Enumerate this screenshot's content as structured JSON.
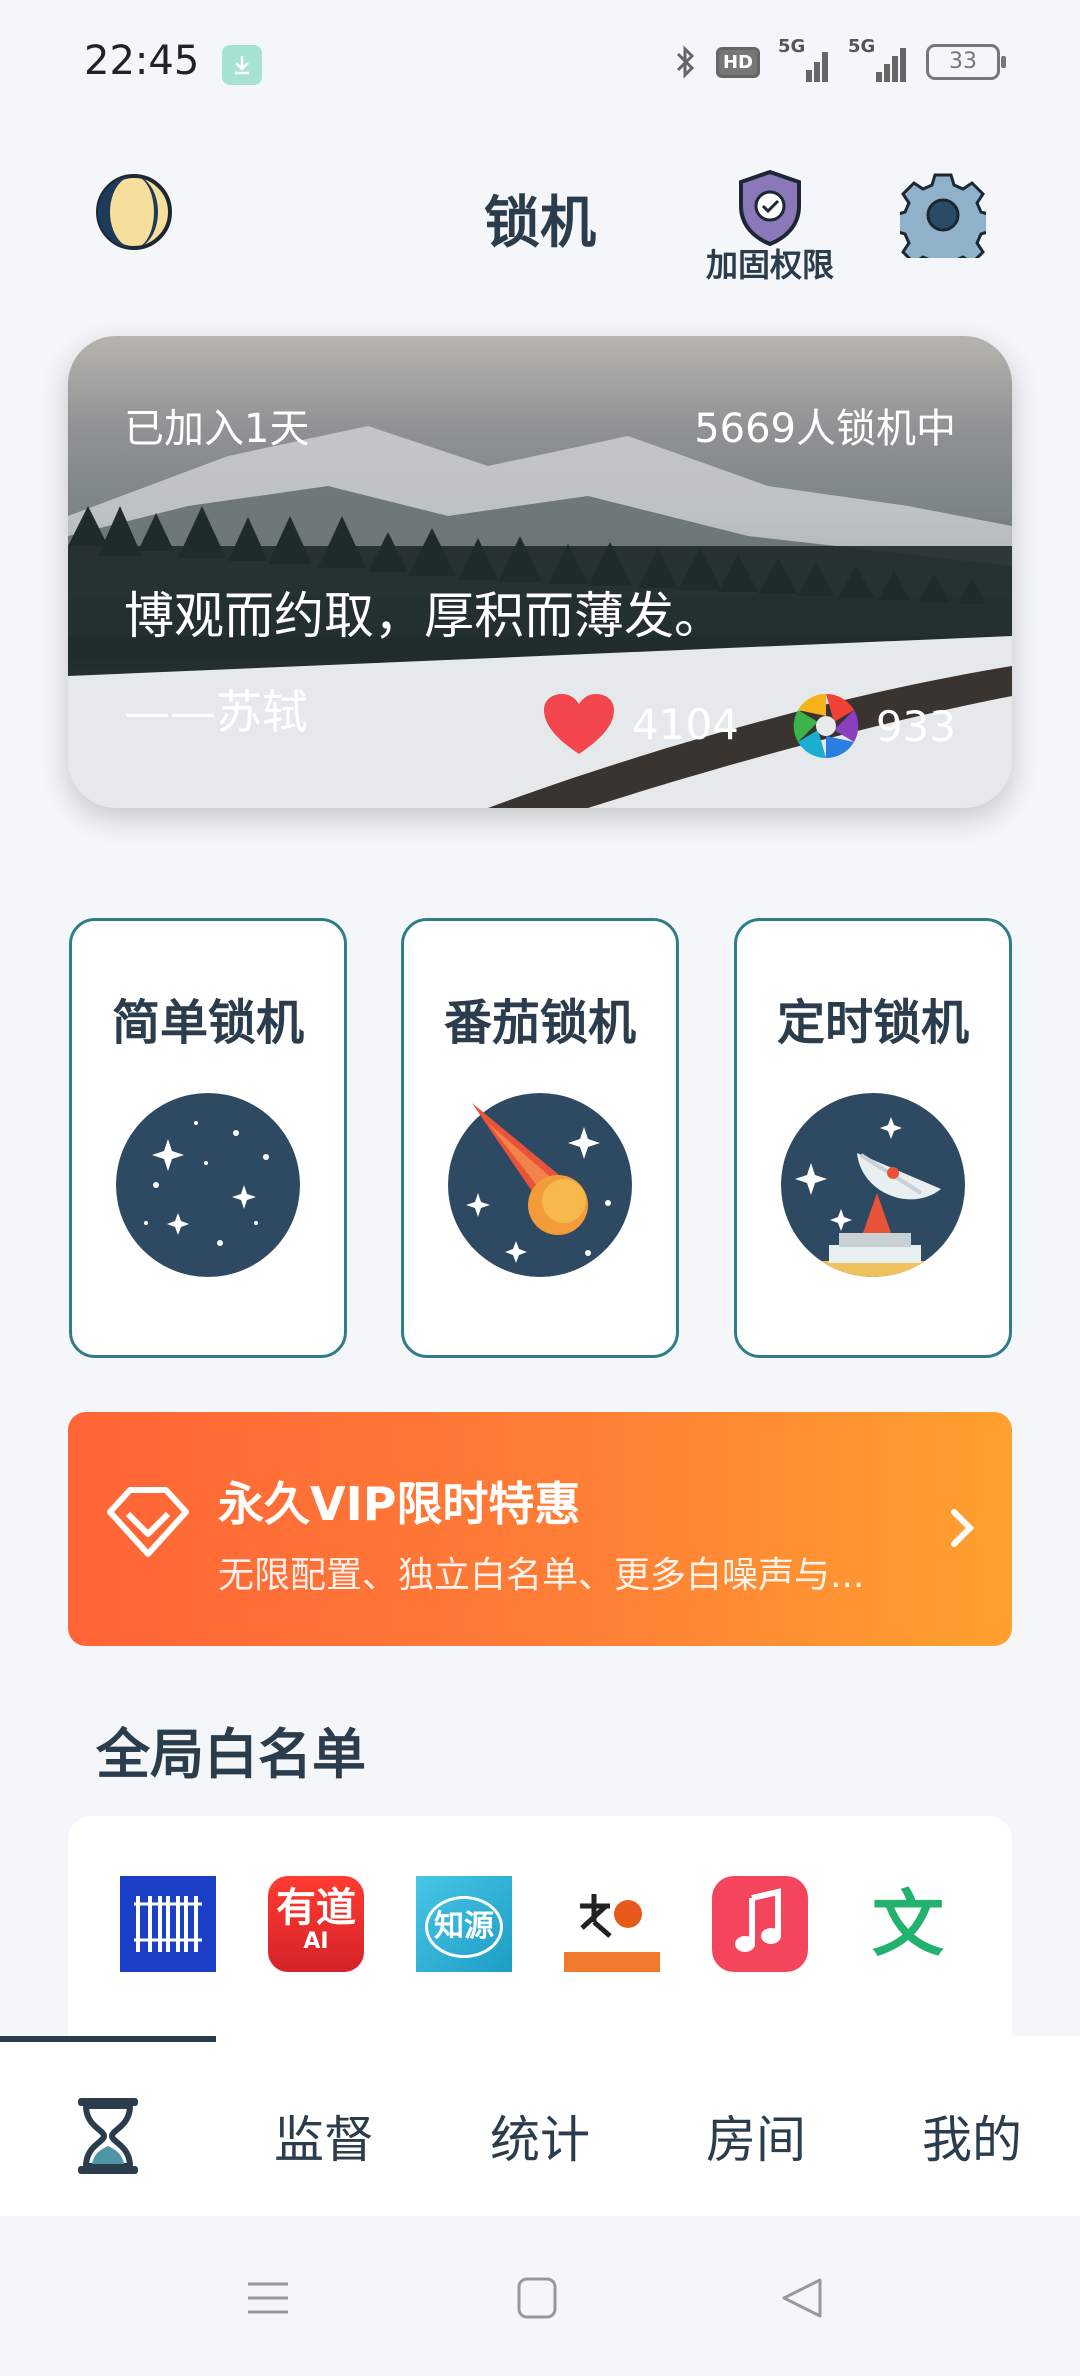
{
  "status_bar": {
    "time": "22:45",
    "network1": "5G",
    "network2": "5G",
    "hd_label": "HD",
    "battery": "33"
  },
  "header": {
    "title": "锁机",
    "shield_label": "加固权限",
    "icons": [
      "moon-icon",
      "shield-icon",
      "gear-icon"
    ]
  },
  "banner": {
    "joined": "已加入1天",
    "online_users": "5669人锁机中",
    "quote": "博观而约取，厚积而薄发。",
    "author": "——苏轼",
    "likes": "4104",
    "shares": "933"
  },
  "modes": [
    {
      "label": "简单锁机",
      "icon": "starry-sky-icon"
    },
    {
      "label": "番茄锁机",
      "icon": "comet-icon"
    },
    {
      "label": "定时锁机",
      "icon": "radar-dish-icon"
    }
  ],
  "vip": {
    "title": "永久VIP限时特惠",
    "subtitle": "无限配置、独立白名单、更多白噪声与..."
  },
  "whitelist": {
    "title": "全局白名单",
    "apps": [
      "barcode-app-icon",
      "youdao-app-icon",
      "zhiyuan-app-icon",
      "dictionary-app-icon",
      "music-app-icon",
      "wen-app-icon"
    ],
    "youdao_label": "有道",
    "youdao_sub": "AI",
    "zhiyuan_label": "知源",
    "wen_label": "文"
  },
  "bottom_nav": {
    "items": [
      "监督",
      "统计",
      "房间",
      "我的"
    ]
  },
  "colors": {
    "primary": "#2b3d4c",
    "accent_teal": "#2f7d8a",
    "vip_start": "#ff6436",
    "vip_end": "#ffa12e",
    "card_circle": "#2d4a62"
  }
}
